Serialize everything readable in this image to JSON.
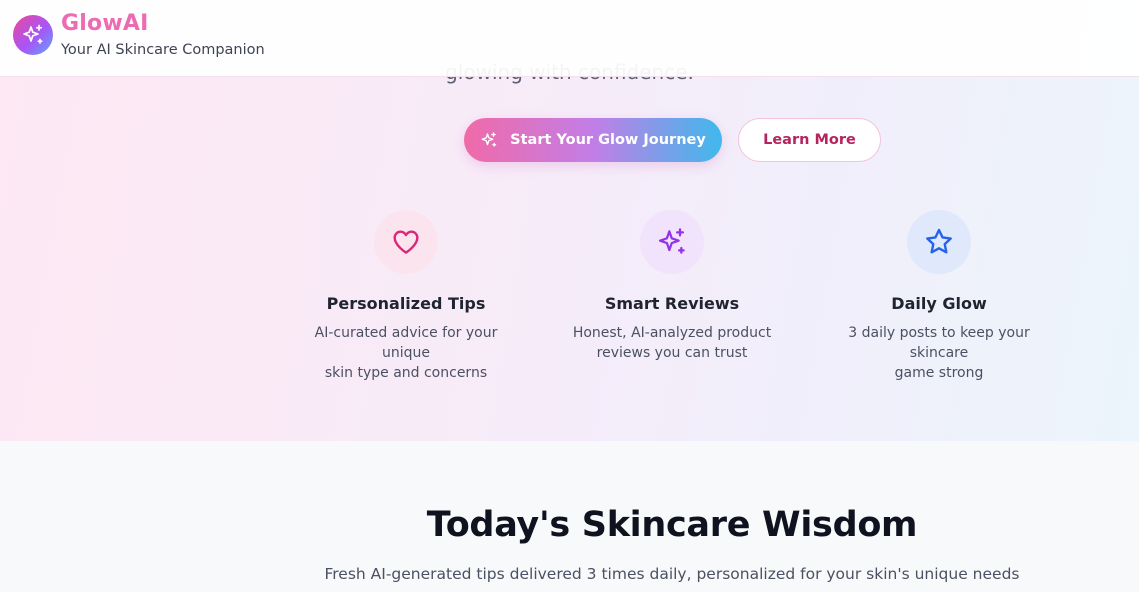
{
  "header": {
    "brand_name": "GlowAI",
    "tagline": "Your AI Skincare Companion",
    "logo_icon": "sparkles-icon"
  },
  "hero": {
    "partial_text": "glowing with confidence.",
    "primary_button": {
      "label": "Start Your Glow Journey",
      "icon": "sparkles-icon"
    },
    "secondary_button": {
      "label": "Learn More"
    }
  },
  "features": [
    {
      "title": "Personalized Tips",
      "desc_line1": "AI-curated advice for your unique",
      "desc_line2": "skin type and concerns",
      "icon": "heart-icon",
      "icon_color": "#db2777",
      "icon_bg": "#fce4ee"
    },
    {
      "title": "Smart Reviews",
      "desc_line1": "Honest, AI-analyzed product",
      "desc_line2": "reviews you can trust",
      "icon": "sparkles-icon",
      "icon_color": "#9333ea",
      "icon_bg": "#f1e3fb"
    },
    {
      "title": "Daily Glow",
      "desc_line1": "3 daily posts to keep your skincare",
      "desc_line2": "game strong",
      "icon": "star-icon",
      "icon_color": "#2563eb",
      "icon_bg": "#dfe9fb"
    }
  ],
  "wisdom": {
    "title": "Today's Skincare Wisdom",
    "subtitle": "Fresh AI-generated tips delivered 3 times daily, personalized for your skin's unique needs"
  },
  "colors": {
    "brand_pink": "#ec6bb1",
    "accent_pink": "#b4245f"
  }
}
